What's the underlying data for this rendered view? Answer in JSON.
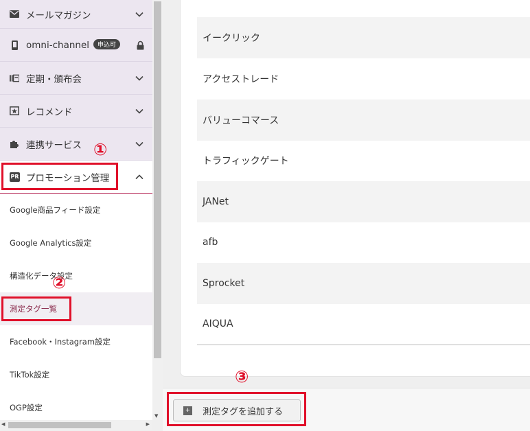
{
  "sidebar": {
    "menus": [
      {
        "label": "メールマガジン",
        "icon": "envelope-icon"
      },
      {
        "label": "omni-channel",
        "badge": "申込可",
        "icon": "phone-icon",
        "locked": true
      },
      {
        "label": "定期・頒布会",
        "icon": "calendar-icon"
      },
      {
        "label": "レコメンド",
        "icon": "star-box-icon"
      },
      {
        "label": "連携サービス",
        "icon": "puzzle-icon"
      },
      {
        "label": "プロモーション管理",
        "icon": "pr-icon",
        "expanded": true
      }
    ],
    "submenu": [
      "Google商品フィード設定",
      "Google Analytics設定",
      "構造化データ設定",
      "測定タグ一覧",
      "Facebook・Instagram設定",
      "TikTok設定",
      "OGP設定"
    ],
    "active_submenu": "測定タグ一覧"
  },
  "tag_list": {
    "rows": [
      "イークリック",
      "アクセストレード",
      "バリューコマース",
      "トラフィックゲート",
      "JANet",
      "afb",
      "Sprocket",
      "AIQUA"
    ]
  },
  "footer": {
    "add_button_label": "測定タグを追加する"
  },
  "annotations": {
    "step1": "①",
    "step2": "②",
    "step3": "③",
    "color": "#e0102a"
  }
}
